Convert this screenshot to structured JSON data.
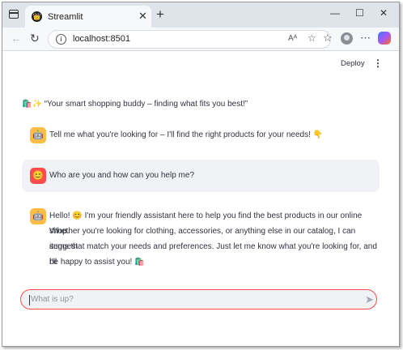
{
  "browser": {
    "tab_title": "Streamlit",
    "tab_logo_glyph": "👑",
    "url": "localhost:8501"
  },
  "app_header": {
    "deploy_label": "Deploy",
    "menu_glyph": "⋮"
  },
  "caption": {
    "emoji": "🛍️✨",
    "text": "“Your smart shopping buddy – finding what fits you best!”"
  },
  "messages": [
    {
      "role": "assistant",
      "avatar": "🤖",
      "lines": [
        "Tell me what you're looking for – I'll find the right products for your needs! 👇"
      ]
    },
    {
      "role": "user",
      "avatar": "😊",
      "lines": [
        "Who are you and how can you help me?"
      ]
    },
    {
      "role": "assistant",
      "avatar": "🤖",
      "lines": [
        "Hello! 😊 I'm your friendly assistant here to help you find the best products in our online shop.",
        "Whether you're looking for clothing, accessories, or anything else in our catalog, I can suggest",
        "items that match your needs and preferences. Just let me know what you're looking for, and I'll",
        "be happy to assist you! 🛍️"
      ]
    }
  ],
  "chat_input": {
    "placeholder": "What is up?"
  },
  "colors": {
    "accent": "#ff4b4b",
    "assistant_avatar": "#ffbd45",
    "user_message_bg": "#f0f2f6",
    "text": "#31333f"
  }
}
